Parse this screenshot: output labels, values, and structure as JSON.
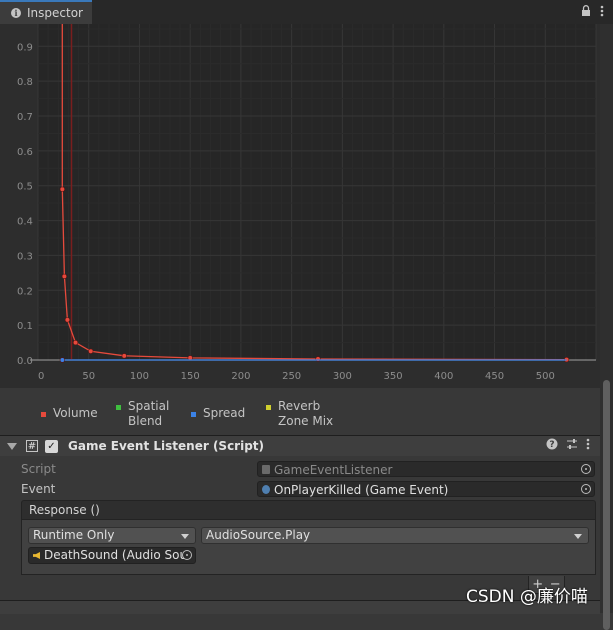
{
  "window": {
    "tab_title": "Inspector",
    "lock_icon": "lock-icon",
    "menu_icon": "kebab-menu-icon"
  },
  "chart_data": {
    "type": "line",
    "title": "",
    "xlabel": "",
    "ylabel": "",
    "xlim": [
      0,
      550
    ],
    "ylim": [
      0,
      1
    ],
    "x_ticks": [
      "0",
      "50",
      "100",
      "150",
      "200",
      "250",
      "300",
      "350",
      "400",
      "450",
      "500"
    ],
    "y_ticks": [
      "0.0",
      "0.1",
      "0.2",
      "0.3",
      "0.4",
      "0.5",
      "0.6",
      "0.7",
      "0.8",
      "0.9"
    ],
    "grid": true,
    "listener_marker_x": 33,
    "series": [
      {
        "name": "Volume",
        "color": "#e64a3c",
        "curve": {
          "x": [
            24,
            24.5,
            25,
            26,
            28,
            30,
            32,
            35,
            38,
            42,
            47,
            55,
            65,
            80,
            100,
            130,
            150,
            200,
            250,
            275,
            350,
            450,
            520
          ],
          "y": [
            1.0,
            0.98,
            0.96,
            0.92,
            0.857,
            0.8,
            0.75,
            0.686,
            0.632,
            0.571,
            0.511,
            0.436,
            0.369,
            0.3,
            0.24,
            0.185,
            0.16,
            0.12,
            0.096,
            0.087,
            0.069,
            0.053,
            0.046
          ]
        },
        "keys": [
          {
            "x": 24,
            "y": 0.49
          },
          {
            "x": 26,
            "y": 0.24
          },
          {
            "x": 29,
            "y": 0.115
          },
          {
            "x": 37,
            "y": 0.05
          },
          {
            "x": 52,
            "y": 0.025
          },
          {
            "x": 85,
            "y": 0.012
          },
          {
            "x": 150,
            "y": 0.006
          },
          {
            "x": 276,
            "y": 0.003
          },
          {
            "x": 521,
            "y": 0.001
          }
        ]
      },
      {
        "name": "Spread",
        "color": "#3b82e6",
        "curve": {
          "x": [
            24,
            521
          ],
          "y": [
            0,
            0
          ]
        },
        "keys": [
          {
            "x": 24,
            "y": 0
          }
        ]
      }
    ]
  },
  "legend": {
    "items": [
      {
        "line1": "Volume",
        "line2": "",
        "color": "#e64a3c"
      },
      {
        "line1": "Spatial",
        "line2": "Blend",
        "color": "#3fbf3f"
      },
      {
        "line1": "Spread",
        "line2": "",
        "color": "#3b82e6"
      },
      {
        "line1": "Reverb",
        "line2": "Zone Mix",
        "color": "#cfcf2e"
      }
    ]
  },
  "component": {
    "title": "Game Event Listener (Script)",
    "enabled": true,
    "script_label": "Script",
    "script_value": "GameEventListener",
    "event_label": "Event",
    "event_value": "OnPlayerKilled (Game Event)",
    "response_header": "Response ()",
    "runtime_dropdown": "Runtime Only",
    "function_dropdown": "AudioSource.Play",
    "target_object": "DeathSound (Audio Sou",
    "add_symbol": "+",
    "remove_symbol": "−"
  },
  "watermark": "CSDN @廉价喵"
}
